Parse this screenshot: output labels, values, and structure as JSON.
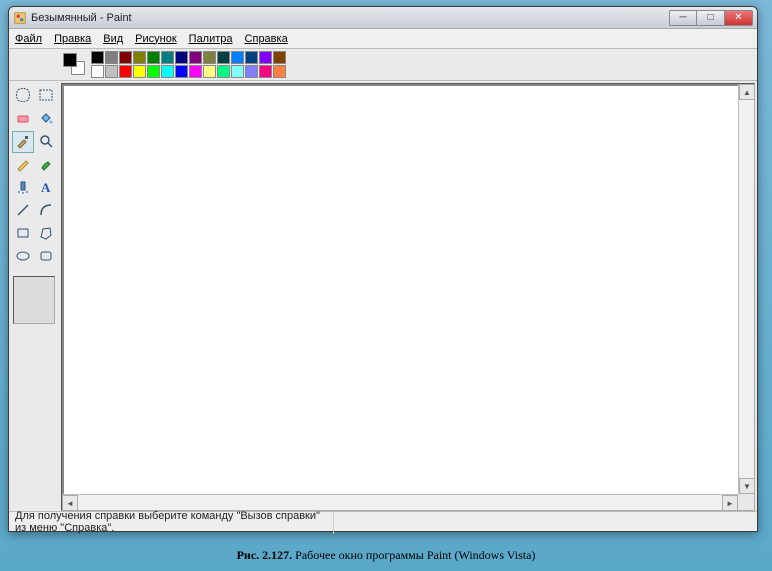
{
  "window": {
    "title": "Безымянный - Paint"
  },
  "menu": {
    "items": [
      {
        "text": "Файл",
        "underline": 0
      },
      {
        "text": "Правка",
        "underline": 0
      },
      {
        "text": "Вид",
        "underline": 0
      },
      {
        "text": "Рисунок",
        "underline": 0
      },
      {
        "text": "Палитра",
        "underline": 0
      },
      {
        "text": "Справка",
        "underline": 0
      }
    ]
  },
  "tools": [
    {
      "name": "free-select",
      "icon": "freeselect"
    },
    {
      "name": "rect-select",
      "icon": "rectselect"
    },
    {
      "name": "eraser",
      "icon": "eraser"
    },
    {
      "name": "fill",
      "icon": "fill"
    },
    {
      "name": "picker",
      "icon": "picker",
      "selected": true
    },
    {
      "name": "magnifier",
      "icon": "magnifier"
    },
    {
      "name": "pencil",
      "icon": "pencil"
    },
    {
      "name": "brush",
      "icon": "brush"
    },
    {
      "name": "airbrush",
      "icon": "airbrush"
    },
    {
      "name": "text",
      "icon": "text"
    },
    {
      "name": "line",
      "icon": "line"
    },
    {
      "name": "curve",
      "icon": "curve"
    },
    {
      "name": "rectangle",
      "icon": "rect"
    },
    {
      "name": "polygon",
      "icon": "polygon"
    },
    {
      "name": "ellipse",
      "icon": "ellipse"
    },
    {
      "name": "round-rect",
      "icon": "roundrect"
    }
  ],
  "colors": {
    "foreground": "#000000",
    "background": "#ffffff",
    "row1": [
      "#000000",
      "#808080",
      "#800000",
      "#808000",
      "#008000",
      "#008080",
      "#000080",
      "#800080",
      "#808040",
      "#004040",
      "#0080ff",
      "#004080",
      "#8000ff",
      "#804000"
    ],
    "row2": [
      "#ffffff",
      "#c0c0c0",
      "#ff0000",
      "#ffff00",
      "#00ff00",
      "#00ffff",
      "#0000ff",
      "#ff00ff",
      "#ffff80",
      "#00ff80",
      "#80ffff",
      "#8080ff",
      "#ff0080",
      "#ff8040"
    ]
  },
  "statusbar": {
    "text": "Для получения справки выберите команду \"Вызов справки\" из меню \"Справка\"."
  },
  "caption": {
    "label": "Рис. 2.127.",
    "text": " Рабочее окно программы Paint (Windows Vista)"
  }
}
